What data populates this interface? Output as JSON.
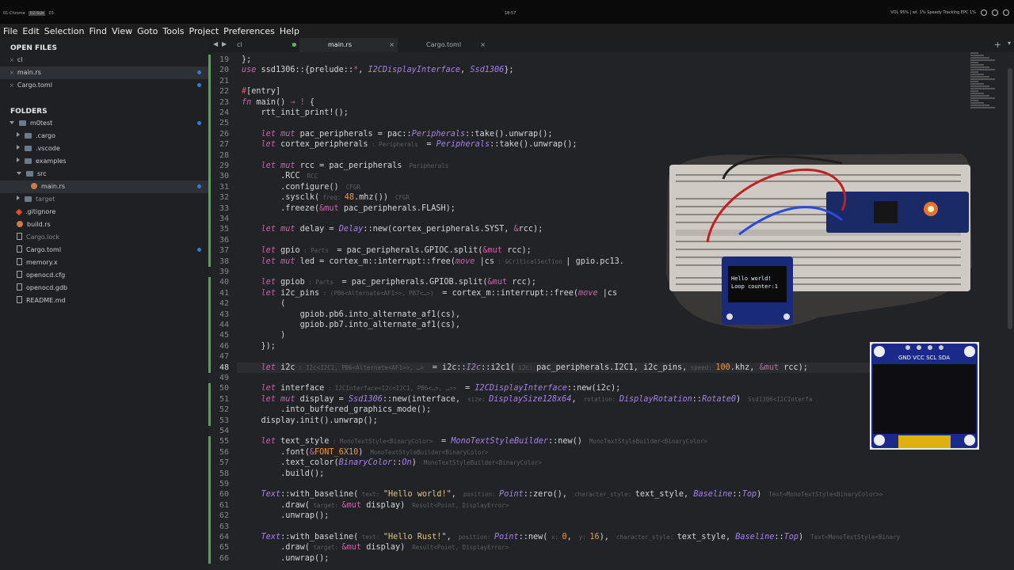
{
  "os_bar": {
    "workspaces": [
      "01-Chrome",
      "02-Sub",
      "03"
    ],
    "clock": "18:57",
    "status": "VOL 95% | wl: 1% Speedy Tracking EPC 1%"
  },
  "menu": [
    "File",
    "Edit",
    "Selection",
    "Find",
    "View",
    "Goto",
    "Tools",
    "Project",
    "Preferences",
    "Help"
  ],
  "sidebar": {
    "open_files_title": "OPEN FILES",
    "open_files": [
      {
        "label": "cl",
        "close": "×"
      },
      {
        "label": "main.rs",
        "close": "×",
        "modified": true
      },
      {
        "label": "Cargo.toml",
        "close": "×",
        "modified": true
      }
    ],
    "folders_title": "FOLDERS",
    "tree": [
      {
        "label": "m0test",
        "kind": "folder-open",
        "depth": 0,
        "modified": true
      },
      {
        "label": ".cargo",
        "kind": "folder",
        "depth": 1
      },
      {
        "label": ".vscode",
        "kind": "folder",
        "depth": 1
      },
      {
        "label": "examples",
        "kind": "folder",
        "depth": 1
      },
      {
        "label": "src",
        "kind": "folder-open",
        "depth": 1
      },
      {
        "label": "main.rs",
        "kind": "rust",
        "depth": 2,
        "selected": true,
        "modified": true
      },
      {
        "label": "target",
        "kind": "folder",
        "depth": 1,
        "dim": true
      },
      {
        "label": ".gitignore",
        "kind": "git",
        "depth": 1
      },
      {
        "label": "build.rs",
        "kind": "rust",
        "depth": 1
      },
      {
        "label": "Cargo.lock",
        "kind": "file",
        "depth": 1,
        "dim": true
      },
      {
        "label": "Cargo.toml",
        "kind": "file",
        "depth": 1,
        "modified": true
      },
      {
        "label": "memory.x",
        "kind": "file",
        "depth": 1
      },
      {
        "label": "openocd.cfg",
        "kind": "file",
        "depth": 1
      },
      {
        "label": "openocd.gdb",
        "kind": "file",
        "depth": 1
      },
      {
        "label": "README.md",
        "kind": "file",
        "depth": 1
      }
    ]
  },
  "tabs": [
    {
      "label": "cl",
      "close": "×"
    },
    {
      "label": "main.rs",
      "close": "×",
      "active": true
    },
    {
      "label": "Cargo.toml",
      "close": "×"
    }
  ],
  "editor": {
    "lines": [
      {
        "n": "19",
        "html": "};"
      },
      {
        "n": "20",
        "html": "<span class=\"kw\">use</span> ssd1306::{prelude::<span class=\"sym\">*</span>, <span class=\"ty\">I2CDisplayInterface</span>, <span class=\"ty\">Ssd1306</span>};"
      },
      {
        "n": "21",
        "html": ""
      },
      {
        "n": "22",
        "html": "<span class=\"sym\">#</span>[entry]"
      },
      {
        "n": "23",
        "html": "<span class=\"kw\">fn</span> main() <span class=\"sym\">→</span> <span class=\"sym\">!</span> {"
      },
      {
        "n": "24",
        "html": "    rtt_init_print!();"
      },
      {
        "n": "25",
        "html": ""
      },
      {
        "n": "26",
        "html": "    <span class=\"kw\">let mut</span> pac_peripherals = pac::<span class=\"ty\">Peripherals</span>::take().unwrap();"
      },
      {
        "n": "27",
        "html": "    <span class=\"kw\">let</span> cortex_peripherals<span class=\"hint\"> : Peripherals </span> = <span class=\"ty\">Peripherals</span>::take().unwrap();"
      },
      {
        "n": "28",
        "html": ""
      },
      {
        "n": "29",
        "html": "    <span class=\"kw\">let mut</span> rcc = pac_peripherals<span class=\"hint\">  Peripherals</span>"
      },
      {
        "n": "30",
        "html": "        .RCC<span class=\"hint\">  RCC</span>"
      },
      {
        "n": "31",
        "html": "        .configure()<span class=\"hint\">  CFGR</span>"
      },
      {
        "n": "32",
        "html": "        .sysclk(<span class=\"hint\"> freq: </span><span class=\"num\">48</span>.mhz())<span class=\"hint\">  CFGR</span>"
      },
      {
        "n": "33",
        "html": "        .freeze(<span class=\"amp\">&amp;mut</span> pac_peripherals.FLASH);"
      },
      {
        "n": "34",
        "html": ""
      },
      {
        "n": "35",
        "html": "    <span class=\"kw\">let mut</span> delay = <span class=\"ty\">Delay</span>::new(cortex_peripherals.SYST, <span class=\"amp\">&amp;</span>rcc);"
      },
      {
        "n": "36",
        "html": ""
      },
      {
        "n": "37",
        "html": "    <span class=\"kw\">let</span> gpio<span class=\"hint\"> : Parts </span> = pac_peripherals.GPIOC.split(<span class=\"amp\">&amp;mut</span> rcc);"
      },
      {
        "n": "38",
        "html": "    <span class=\"kw\">let mut</span> led = cortex_m::interrupt::free(<span class=\"kw\">move</span> |cs<span class=\"hint\"> : &amp;CriticalSection </span>| gpio.pc13."
      },
      {
        "n": "39",
        "html": ""
      },
      {
        "n": "40",
        "html": "    <span class=\"kw\">let</span> gpiob<span class=\"hint\"> : Parts </span> = pac_peripherals.GPIOB.split(<span class=\"amp\">&amp;mut</span> rcc);"
      },
      {
        "n": "41",
        "html": "    <span class=\"kw\">let</span> i2c_pins<span class=\"hint\"> : (PB6&lt;Alternate&lt;AF1&gt;&gt;, PB7&lt;…&gt;) </span> = cortex_m::interrupt::free(<span class=\"kw\">move</span> |cs"
      },
      {
        "n": "42",
        "html": "        ("
      },
      {
        "n": "43",
        "html": "            gpiob.pb6.into_alternate_af1(cs),"
      },
      {
        "n": "44",
        "html": "            gpiob.pb7.into_alternate_af1(cs),"
      },
      {
        "n": "45",
        "html": "        )"
      },
      {
        "n": "46",
        "html": "    });"
      },
      {
        "n": "47",
        "html": ""
      },
      {
        "n": "48",
        "html": "    <span class=\"kw\">let</span> i2c<span class=\"hint\"> : I2c&lt;I2C1, PB6&lt;Alternate&lt;AF1&gt;&gt;, …&gt; </span> = i2c::<span class=\"ty\">I2c</span>::i2c1(<span class=\"hint\"> i2c: </span>pac_peripherals.I2C1, i2c_pins,<span class=\"hint\"> speed: </span><span class=\"num\">100</span>.khz, <span class=\"amp\">&amp;mut</span> rcc);",
        "current": true
      },
      {
        "n": "49",
        "html": ""
      },
      {
        "n": "50",
        "html": "    <span class=\"kw\">let</span> interface<span class=\"hint\"> : I2CInterface&lt;I2c&lt;I2C1, PB6&lt;…&gt;, …&gt;&gt; </span> = <span class=\"ty\">I2CDisplayInterface</span>::new(i2c);"
      },
      {
        "n": "51",
        "html": "    <span class=\"kw\">let mut</span> display = <span class=\"ty\">Ssd1306</span>::new(interface,<span class=\"hint\">  size: </span><span class=\"ty\">DisplaySize128x64</span>,<span class=\"hint\">  rotation: </span><span class=\"ty\">DisplayRotation</span>::<span class=\"ty\">Rotate0</span>)<span class=\"hint\">  Ssd1306&lt;I2CInterfa</span>"
      },
      {
        "n": "52",
        "html": "        .into_buffered_graphics_mode();"
      },
      {
        "n": "53",
        "html": "    display.init().unwrap();"
      },
      {
        "n": "54",
        "html": ""
      },
      {
        "n": "55",
        "html": "    <span class=\"kw\">let</span> text_style<span class=\"hint\"> : MonoTextStyle&lt;BinaryColor&gt; </span> = <span class=\"ty\">MonoTextStyleBuilder</span>::new()<span class=\"hint\">  MonoTextStyleBuilder&lt;BinaryColor&gt;</span>"
      },
      {
        "n": "56",
        "html": "        .font(<span class=\"amp\">&amp;</span><span class=\"num\">FONT_6X10</span>)<span class=\"hint\">  MonoTextStyleBuilder&lt;BinaryColor&gt;</span>"
      },
      {
        "n": "57",
        "html": "        .text_color(<span class=\"ty\">BinaryColor</span>::<span class=\"ty\">On</span>)<span class=\"hint\">  MonoTextStyleBuilder&lt;BinaryColor&gt;</span>"
      },
      {
        "n": "58",
        "html": "        .build();"
      },
      {
        "n": "59",
        "html": ""
      },
      {
        "n": "60",
        "html": "    <span class=\"ty\">Text</span>::with_baseline(<span class=\"hint\"> text: </span><span class=\"str\">\"Hello world!\"</span>,<span class=\"hint\">  position: </span><span class=\"ty\">Point</span>::zero(),<span class=\"hint\">  character_style: </span>text_style, <span class=\"ty\">Baseline</span>::<span class=\"ty\">Top</span>)<span class=\"hint\">  Text&lt;MonoTextStyle&lt;BinaryColor&gt;&gt;</span>"
      },
      {
        "n": "61",
        "html": "        .draw(<span class=\"hint\"> target: </span><span class=\"amp\">&amp;mut</span> display)<span class=\"hint\">  Result&lt;Point, DisplayError&gt;</span>"
      },
      {
        "n": "62",
        "html": "        .unwrap();"
      },
      {
        "n": "63",
        "html": ""
      },
      {
        "n": "64",
        "html": "    <span class=\"ty\">Text</span>::with_baseline(<span class=\"hint\"> text: </span><span class=\"str\">\"Hello Rust!\"</span>,<span class=\"hint\">  position: </span><span class=\"ty\">Point</span>::new(<span class=\"hint\"> x: </span><span class=\"num\">0</span>,<span class=\"hint\">  y: </span><span class=\"num\">16</span>),<span class=\"hint\">  character_style: </span>text_style, <span class=\"ty\">Baseline</span>::<span class=\"ty\">Top</span>)<span class=\"hint\">  Text&lt;MonoTextStyle&lt;Binary</span>"
      },
      {
        "n": "65",
        "html": "        .draw(<span class=\"hint\"> target: </span><span class=\"amp\">&amp;mut</span> display)<span class=\"hint\">  Result&lt;Point, DisplayError&gt;</span>"
      },
      {
        "n": "66",
        "html": "        .unwrap();"
      }
    ],
    "changed_ranges": [
      [
        "19",
        "38"
      ],
      [
        "40",
        "48"
      ],
      [
        "50",
        "53"
      ],
      [
        "55",
        "66"
      ]
    ]
  },
  "overlay_photo_breadboard": {
    "oled_text_line1": "Hello world!",
    "oled_text_line2": "Loop counter:1"
  },
  "overlay_photo_module": {
    "pin_labels": "GND VCC SCL SDA"
  },
  "colors": {
    "keyword": "#c468a6",
    "type": "#a582e8",
    "number": "#e99a3f",
    "string": "#e0c878",
    "changed": "#4fa84a",
    "modified_dot": "#3a78d6"
  }
}
